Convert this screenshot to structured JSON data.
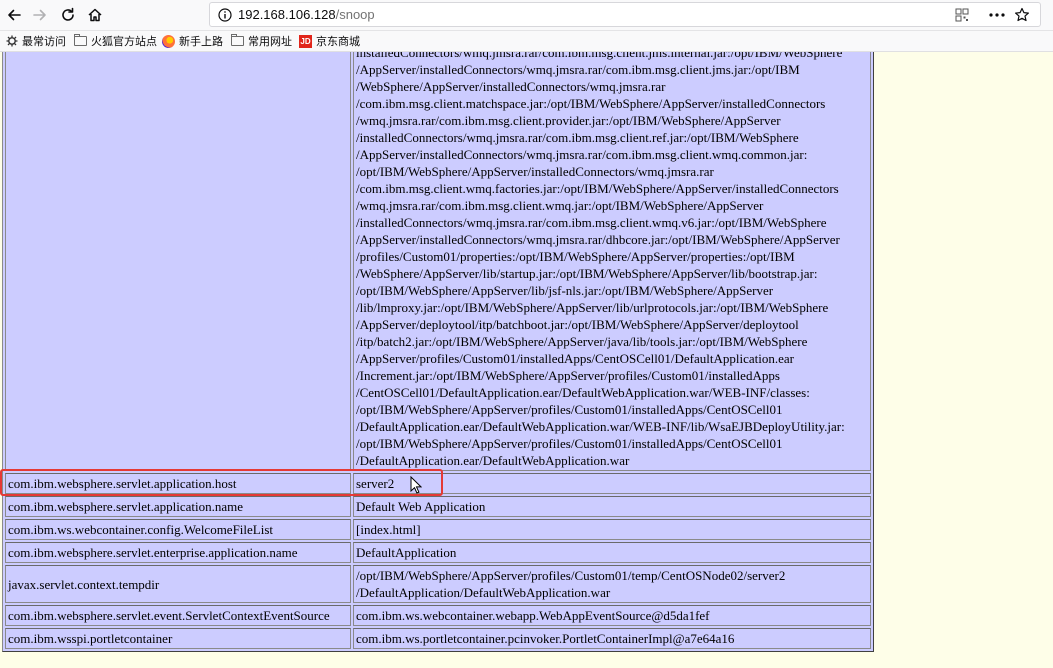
{
  "browser": {
    "url_host": "192.168.106.128",
    "url_path": "/snoop",
    "bookmarks": [
      {
        "label": "最常访问",
        "icon": "gear-icon"
      },
      {
        "label": "火狐官方站点",
        "icon": "folder-icon"
      },
      {
        "label": "新手上路",
        "icon": "firefox-icon"
      },
      {
        "label": "常用网址",
        "icon": "folder-icon"
      },
      {
        "label": "京东商城",
        "icon": "jd-icon"
      }
    ]
  },
  "classpath_lines": [
    "installedConnectors/wmq.jmsra.rar/com.ibm.msg.client.jms.internal.jar:/opt/IBM/WebSphere",
    "/AppServer/installedConnectors/wmq.jmsra.rar/com.ibm.msg.client.jms.jar:/opt/IBM",
    "/WebSphere/AppServer/installedConnectors/wmq.jmsra.rar",
    "/com.ibm.msg.client.matchspace.jar:/opt/IBM/WebSphere/AppServer/installedConnectors",
    "/wmq.jmsra.rar/com.ibm.msg.client.provider.jar:/opt/IBM/WebSphere/AppServer",
    "/installedConnectors/wmq.jmsra.rar/com.ibm.msg.client.ref.jar:/opt/IBM/WebSphere",
    "/AppServer/installedConnectors/wmq.jmsra.rar/com.ibm.msg.client.wmq.common.jar:",
    "/opt/IBM/WebSphere/AppServer/installedConnectors/wmq.jmsra.rar",
    "/com.ibm.msg.client.wmq.factories.jar:/opt/IBM/WebSphere/AppServer/installedConnectors",
    "/wmq.jmsra.rar/com.ibm.msg.client.wmq.jar:/opt/IBM/WebSphere/AppServer",
    "/installedConnectors/wmq.jmsra.rar/com.ibm.msg.client.wmq.v6.jar:/opt/IBM/WebSphere",
    "/AppServer/installedConnectors/wmq.jmsra.rar/dhbcore.jar:/opt/IBM/WebSphere/AppServer",
    "/profiles/Custom01/properties:/opt/IBM/WebSphere/AppServer/properties:/opt/IBM",
    "/WebSphere/AppServer/lib/startup.jar:/opt/IBM/WebSphere/AppServer/lib/bootstrap.jar:",
    "/opt/IBM/WebSphere/AppServer/lib/jsf-nls.jar:/opt/IBM/WebSphere/AppServer",
    "/lib/lmproxy.jar:/opt/IBM/WebSphere/AppServer/lib/urlprotocols.jar:/opt/IBM/WebSphere",
    "/AppServer/deploytool/itp/batchboot.jar:/opt/IBM/WebSphere/AppServer/deploytool",
    "/itp/batch2.jar:/opt/IBM/WebSphere/AppServer/java/lib/tools.jar:/opt/IBM/WebSphere",
    "/AppServer/profiles/Custom01/installedApps/CentOSCell01/DefaultApplication.ear",
    "/Increment.jar:/opt/IBM/WebSphere/AppServer/profiles/Custom01/installedApps",
    "/CentOSCell01/DefaultApplication.ear/DefaultWebApplication.war/WEB-INF/classes:",
    "/opt/IBM/WebSphere/AppServer/profiles/Custom01/installedApps/CentOSCell01",
    "/DefaultApplication.ear/DefaultWebApplication.war/WEB-INF/lib/WsaEJBDeployUtility.jar:",
    "/opt/IBM/WebSphere/AppServer/profiles/Custom01/installedApps/CentOSCell01",
    "/DefaultApplication.ear/DefaultWebApplication.war"
  ],
  "rows": [
    {
      "key": "com.ibm.websphere.servlet.application.host",
      "value": [
        "server2"
      ]
    },
    {
      "key": "com.ibm.websphere.servlet.application.name",
      "value": [
        "Default Web Application"
      ]
    },
    {
      "key": "com.ibm.ws.webcontainer.config.WelcomeFileList",
      "value": [
        "[index.html]"
      ]
    },
    {
      "key": "com.ibm.websphere.servlet.enterprise.application.name",
      "value": [
        "DefaultApplication"
      ]
    },
    {
      "key": "javax.servlet.context.tempdir",
      "value": [
        "/opt/IBM/WebSphere/AppServer/profiles/Custom01/temp/CentOSNode02/server2",
        "/DefaultApplication/DefaultWebApplication.war"
      ]
    },
    {
      "key": "com.ibm.websphere.servlet.event.ServletContextEventSource",
      "value": [
        "com.ibm.ws.webcontainer.webapp.WebAppEventSource@d5da1fef"
      ]
    },
    {
      "key": "com.ibm.wsspi.portletcontainer",
      "value": [
        "com.ibm.ws.portletcontainer.pcinvoker.PortletContainerImpl@a7e64a16"
      ]
    }
  ],
  "colors": {
    "highlight": "#e53935",
    "cell_bg": "#ccccff",
    "page_bg": "#fefee8"
  }
}
